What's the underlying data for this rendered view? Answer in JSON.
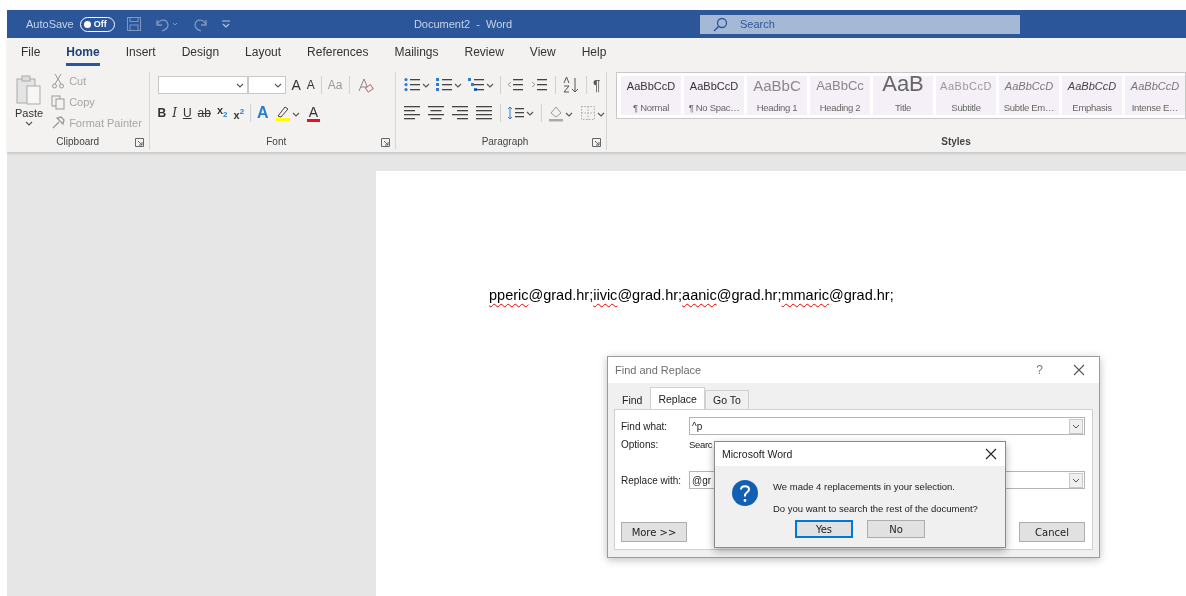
{
  "title_bar": {
    "autosave_label": "AutoSave",
    "autosave_toggle": {
      "label": "Off",
      "on": false
    },
    "document_title": "Document2  -  Word",
    "search": {
      "placeholder": "Search"
    }
  },
  "menu_tabs": [
    {
      "label": "File",
      "selected": false
    },
    {
      "label": "Home",
      "selected": true
    },
    {
      "label": "Insert",
      "selected": false
    },
    {
      "label": "Design",
      "selected": false
    },
    {
      "label": "Layout",
      "selected": false
    },
    {
      "label": "References",
      "selected": false
    },
    {
      "label": "Mailings",
      "selected": false
    },
    {
      "label": "Review",
      "selected": false
    },
    {
      "label": "View",
      "selected": false
    },
    {
      "label": "Help",
      "selected": false
    }
  ],
  "ribbon": {
    "clipboard": {
      "label": "Clipboard",
      "paste": "Paste",
      "cut": "Cut",
      "copy": "Copy",
      "format_painter": "Format Painter"
    },
    "font": {
      "label": "Font",
      "grow": "A",
      "shrink": "A",
      "change_case": "Aa",
      "format_buttons": [
        {
          "label": "B",
          "kind": "bold"
        },
        {
          "label": "I",
          "kind": "italic"
        },
        {
          "label": "U",
          "kind": "underline"
        },
        {
          "label": "ab",
          "kind": "strike"
        },
        {
          "label": "x$_{2}$",
          "kind": "plain"
        },
        {
          "label": "x$^{2}$",
          "kind": "plain"
        }
      ],
      "text_effects": "A",
      "font_color": "A"
    },
    "paragraph": {
      "label": "Paragraph",
      "show_marks": "¶"
    },
    "styles": {
      "label": "Styles",
      "items": [
        {
          "preview": "AaBbCcD",
          "name": "¶ Normal",
          "kind": "normal"
        },
        {
          "preview": "AaBbCcD",
          "name": "¶ No Spac…",
          "kind": "normal"
        },
        {
          "preview": "AaBbC",
          "name": "Heading 1",
          "kind": "heading1"
        },
        {
          "preview": "AaBbCc",
          "name": "Heading 2",
          "kind": "heading2"
        },
        {
          "preview": "AaB",
          "name": "Title",
          "kind": "title"
        },
        {
          "preview": "AaBbCcD",
          "name": "Subtitle",
          "kind": "subtitle"
        },
        {
          "preview": "AaBbCcD",
          "name": "Subtle Em…",
          "kind": "subtle"
        },
        {
          "preview": "AaBbCcD",
          "name": "Emphasis",
          "kind": "emphasis"
        },
        {
          "preview": "AaBbCcD",
          "name": "Intense E…",
          "kind": "subtle"
        }
      ]
    }
  },
  "document": {
    "segments": [
      {
        "text": "pperic",
        "misspelled": true
      },
      {
        "text": "@grad.hr;",
        "misspelled": false
      },
      {
        "text": "iivic",
        "misspelled": true
      },
      {
        "text": "@grad.hr;",
        "misspelled": false
      },
      {
        "text": "aanic",
        "misspelled": true
      },
      {
        "text": "@grad.hr;",
        "misspelled": false
      },
      {
        "text": "mmaric",
        "misspelled": true
      },
      {
        "text": "@grad.hr;",
        "misspelled": false
      }
    ]
  },
  "find_replace": {
    "title": "Find and Replace",
    "help": "?",
    "tabs": [
      {
        "label": "Find",
        "selected": false
      },
      {
        "label": "Replace",
        "selected": true
      },
      {
        "label": "Go To",
        "selected": false
      }
    ],
    "find_label": "Find what:",
    "find_value": "^p",
    "options_label": "Options:",
    "options_value": "Searc",
    "replace_label": "Replace with:",
    "replace_value": "@gr",
    "more_button": "More >>",
    "cancel_button": "Cancel"
  },
  "message_box": {
    "title": "Microsoft Word",
    "message": "We made 4 replacements in your selection.",
    "question": "Do you want to search the rest of the document?",
    "buttons": [
      {
        "label": "Yes",
        "selected": true
      },
      {
        "label": "No",
        "selected": false
      }
    ]
  }
}
